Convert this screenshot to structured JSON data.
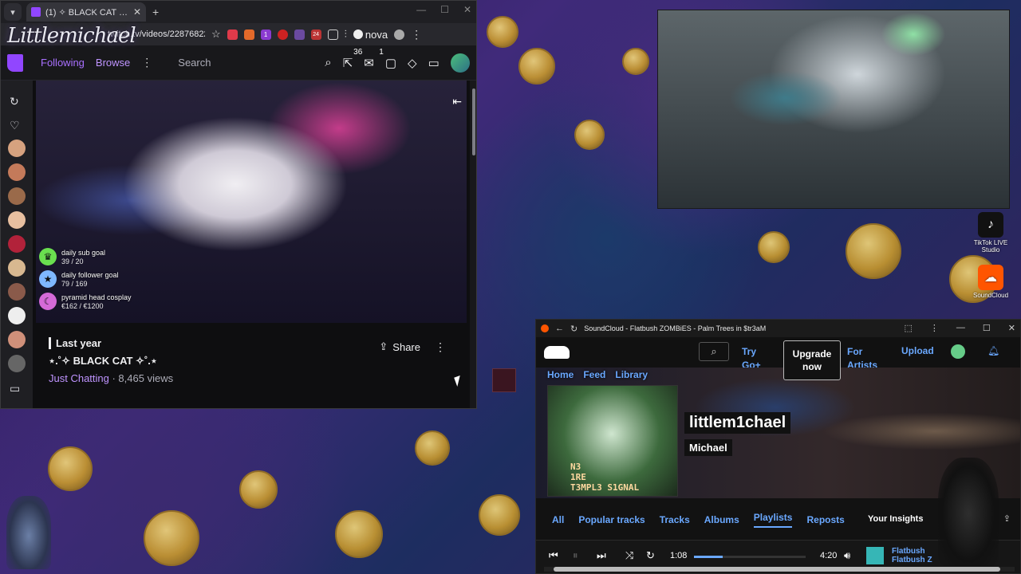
{
  "browser": {
    "tab_title": "(1) ✧ BLACK CAT ✧ - Twitch",
    "tab_close": "✕",
    "new_tab": "+",
    "window_controls": [
      "—",
      "☐",
      "✕"
    ],
    "url": "twitch.tv/videos/22876822...",
    "profile_label": "nova",
    "ext_badge_1": "1",
    "ext_badge_2": "24",
    "logo_overlay": "Littlemichael"
  },
  "twitch_nav": {
    "following": "Following",
    "browse": "Browse",
    "search_placeholder": "Search",
    "badge_prime": "36",
    "badge_inbox": "1"
  },
  "stream_goals": [
    {
      "label": "daily sub goal",
      "value": "39 / 20"
    },
    {
      "label": "daily follower goal",
      "value": "79 / 169"
    },
    {
      "label": "pyramid head cosplay",
      "value": "€162 / €1200"
    }
  ],
  "video": {
    "date": "Last year",
    "title": "⋆.˚✧ BLACK CAT ✧˚.⋆",
    "category": "Just Chatting",
    "views": " · 8,465 views",
    "share": "Share"
  },
  "desktop_icons": [
    {
      "name": "tiktok",
      "label": "TikTok LIVE Studio"
    },
    {
      "name": "soundcloud",
      "label": "SoundCloud"
    }
  ],
  "soundcloud": {
    "window_title": "SoundCloud - Flatbush ZOMBiES - Palm Trees in $tr3aM",
    "try_go": "Try Go+",
    "upgrade": "Upgrade now",
    "for_artists": "For Artists",
    "upload": "Upload",
    "subnav": [
      "Home",
      "Feed",
      "Library"
    ],
    "art_text": "N3\n1RE\nT3MPL3 S1GNAL",
    "username": "littlem1chael",
    "realname": "Michael",
    "tabs": [
      "All",
      "Popular tracks",
      "Tracks",
      "Albums",
      "Playlists",
      "Reposts"
    ],
    "active_tab": "Playlists",
    "insights": "Your Insights",
    "player": {
      "elapsed": "1:08",
      "duration": "4:20",
      "progress": 0.26,
      "track_artist": "Flatbush",
      "track_title": "Flatbush Z"
    }
  }
}
